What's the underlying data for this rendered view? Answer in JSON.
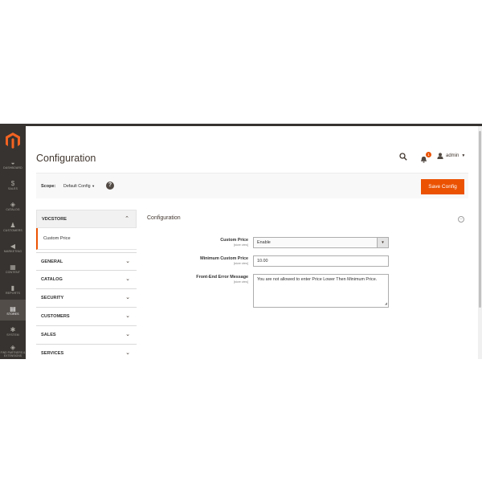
{
  "nav": {
    "items": [
      {
        "label": "DASHBOARD",
        "icon": "dashboard-icon",
        "glyph": "◒"
      },
      {
        "label": "SALES",
        "icon": "dollar-icon",
        "glyph": "$"
      },
      {
        "label": "CATALOG",
        "icon": "cube-icon",
        "glyph": "◈"
      },
      {
        "label": "CUSTOMERS",
        "icon": "person-icon",
        "glyph": "♟"
      },
      {
        "label": "MARKETING",
        "icon": "megaphone-icon",
        "glyph": "◀"
      },
      {
        "label": "CONTENT",
        "icon": "layout-icon",
        "glyph": "▦"
      },
      {
        "label": "REPORTS",
        "icon": "bar-chart-icon",
        "glyph": "▮"
      },
      {
        "label": "STORES",
        "icon": "store-icon",
        "glyph": "▤"
      },
      {
        "label": "SYSTEM",
        "icon": "gear-icon",
        "glyph": "✱"
      },
      {
        "label": "FIND PARTNERS & EXTENSIONS",
        "icon": "box-icon",
        "glyph": "◈"
      }
    ],
    "active": "STORES"
  },
  "header": {
    "title": "Configuration",
    "notification_count": "1",
    "user": "admin"
  },
  "scope": {
    "label": "Scope:",
    "value": "Default Config",
    "help": "?",
    "save_label": "Save Config"
  },
  "tabs": {
    "open_section": "VDCSTORE",
    "open_item": "Custom Price",
    "collapsed": [
      "GENERAL",
      "CATALOG",
      "SECURITY",
      "CUSTOMERS",
      "SALES",
      "SERVICES"
    ]
  },
  "section": {
    "title": "Configuration",
    "fields": [
      {
        "label": "Custom Price",
        "scope": "[store view]",
        "value": "Enable"
      },
      {
        "label": "Minimum Custom Price",
        "scope": "[store view]",
        "value": "10.00"
      },
      {
        "label": "Front-End Error Message",
        "scope": "[store view]",
        "value": "You are not allowed to enter Price Lower Then Minimum Price."
      }
    ]
  },
  "colors": {
    "accent": "#eb5202",
    "nav_bg": "#373330"
  }
}
